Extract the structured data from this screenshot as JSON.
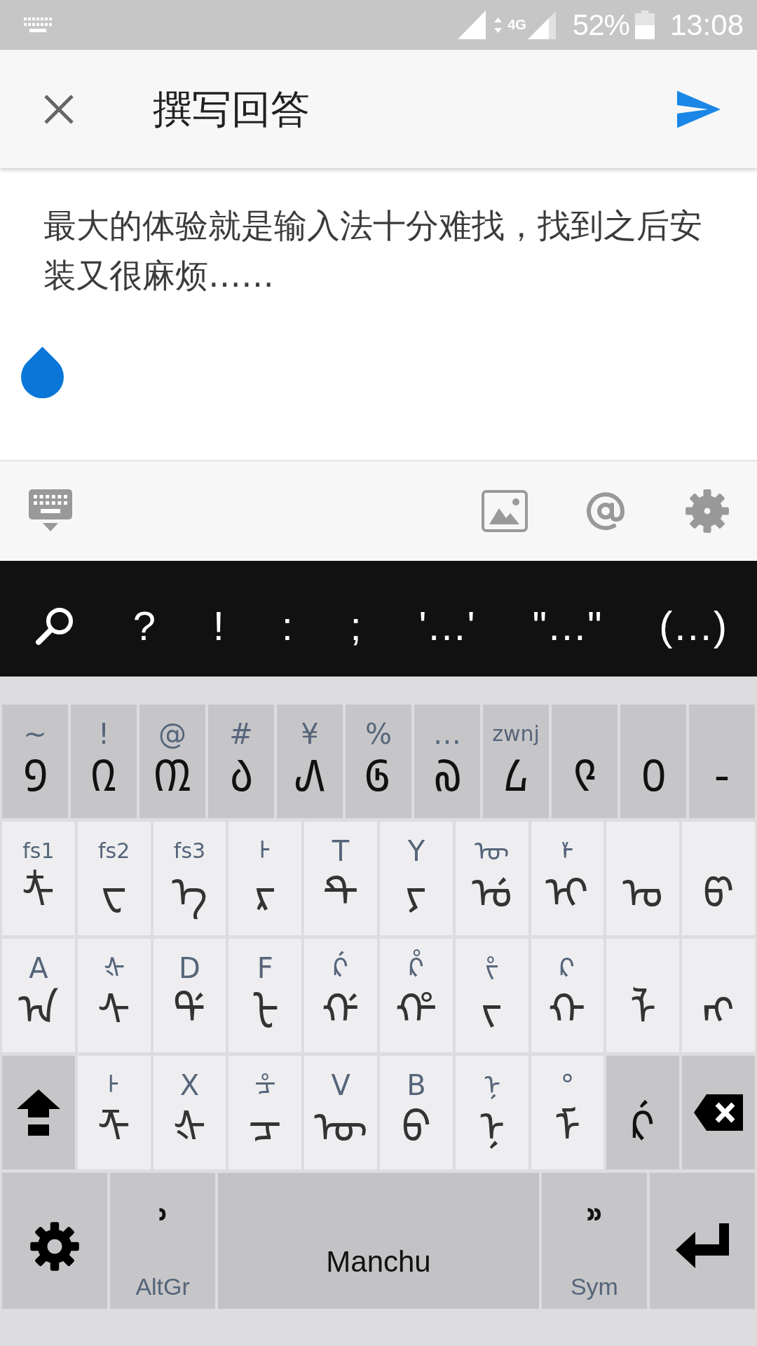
{
  "status_bar": {
    "network": "4G",
    "battery": "52%",
    "time": "13:08"
  },
  "header": {
    "title": "撰写回答"
  },
  "answer": {
    "value": "最大的体验就是输入法十分难找，找到之后安装又很麻烦……"
  },
  "punctuation_bar": {
    "items": [
      "?",
      "!",
      ":",
      ";",
      "'…'",
      "\"…\"",
      "(…)"
    ]
  },
  "keyboard": {
    "rows": [
      [
        {
          "kind": "dark",
          "main": "᠑",
          "hint": "~"
        },
        {
          "kind": "dark",
          "main": "᠒",
          "hint": "!"
        },
        {
          "kind": "dark",
          "main": "᠓",
          "hint": "@"
        },
        {
          "kind": "dark",
          "main": "᠔",
          "hint": "#"
        },
        {
          "kind": "dark",
          "main": "᠕",
          "hint": "¥"
        },
        {
          "kind": "dark",
          "main": "᠖",
          "hint": "%"
        },
        {
          "kind": "dark",
          "main": "᠗",
          "hint": "…"
        },
        {
          "kind": "dark",
          "main": "᠘",
          "hint": "zwnj"
        },
        {
          "kind": "dark",
          "main": "᠙"
        },
        {
          "kind": "dark",
          "main": "᠐"
        },
        {
          "kind": "dark",
          "main": "-"
        }
      ],
      [
        {
          "kind": "light",
          "main": "ᡮ",
          "hint": "fs1"
        },
        {
          "kind": "light",
          "main": "ᠸ",
          "hint": "fs2"
        },
        {
          "kind": "light",
          "main": "ᡝ",
          "hint": "fs3"
        },
        {
          "kind": "light",
          "main": "ᡵ",
          "hint": "ᡰ"
        },
        {
          "kind": "light",
          "main": "ᡨ",
          "hint": "T"
        },
        {
          "kind": "light",
          "main": "ᠶ",
          "hint": "Y"
        },
        {
          "kind": "light",
          "main": "ᡠ",
          "hint": "ᡡ"
        },
        {
          "kind": "light",
          "main": "ᡳ",
          "hint": "ᡟ"
        },
        {
          "kind": "light",
          "main": "ᠣ"
        },
        {
          "kind": "light",
          "main": "ᡦ"
        }
      ],
      [
        {
          "kind": "light",
          "main": "ᠠ",
          "hint": "A"
        },
        {
          "kind": "light",
          "main": "ᠰ",
          "hint": "ᡧ"
        },
        {
          "kind": "light",
          "main": "ᡩ",
          "hint": "D"
        },
        {
          "kind": "light",
          "main": "ᡶ",
          "hint": "F"
        },
        {
          "kind": "light",
          "main": "ᡤ",
          "hint": "ᡬ"
        },
        {
          "kind": "light",
          "main": "ᡥ",
          "hint": "ᡭ"
        },
        {
          "kind": "light",
          "main": "ᠵ",
          "hint": "ᡷ"
        },
        {
          "kind": "light",
          "main": "ᡴ",
          "hint": "ᠺ"
        },
        {
          "kind": "light",
          "main": "ᠯ"
        },
        {
          "kind": "light",
          "main": "ᠩ"
        }
      ],
      [
        {
          "kind": "shift"
        },
        {
          "kind": "light",
          "main": "ᡯ",
          "hint": "ᡰ"
        },
        {
          "kind": "light",
          "main": "ᡧ",
          "hint": "X"
        },
        {
          "kind": "light",
          "main": "ᠴ",
          "hint": "ᡱ"
        },
        {
          "kind": "light",
          "main": "ᡡ",
          "hint": "V"
        },
        {
          "kind": "light",
          "main": "ᠪ",
          "hint": "B"
        },
        {
          "kind": "light",
          "main": "ᠨ",
          "hint": "ᠨ"
        },
        {
          "kind": "light",
          "main": "ᠮ",
          "hint": "°"
        },
        {
          "kind": "dark",
          "main": "ᡬ"
        },
        {
          "kind": "backspace"
        }
      ]
    ],
    "bottom_row": [
      {
        "kind": "settings"
      },
      {
        "kind": "mod",
        "main": "᠈",
        "label": "AltGr"
      },
      {
        "kind": "space",
        "label": "Manchu"
      },
      {
        "kind": "mod",
        "main": "᠉",
        "label": "Sym"
      },
      {
        "kind": "enter"
      }
    ]
  }
}
